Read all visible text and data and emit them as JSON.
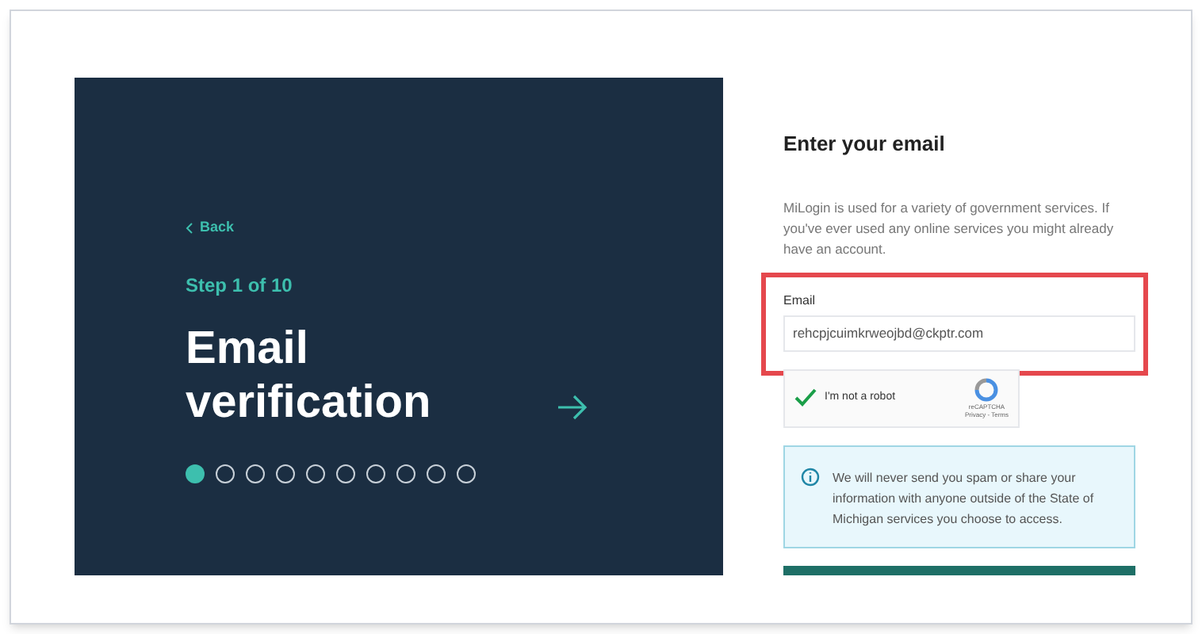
{
  "left_panel": {
    "back_link": "Back",
    "step_label": "Step 1 of 10",
    "title": "Email verification",
    "steps": [
      {
        "selected": true
      },
      {
        "selected": false
      },
      {
        "selected": false
      },
      {
        "selected": false
      },
      {
        "selected": false
      },
      {
        "selected": false
      },
      {
        "selected": false
      },
      {
        "selected": false
      },
      {
        "selected": false
      },
      {
        "selected": false
      }
    ]
  },
  "form": {
    "heading": "Enter your email",
    "intro": "MiLogin is used for a variety of government services. If you've ever used any online services you might already have an account.",
    "email_label": "Email",
    "email_value": "rehcpjcuimkrweojbd@ckptr.com",
    "captcha": {
      "label": "I'm not a robot",
      "checked": true,
      "brand": "reCAPTCHA",
      "links": "Privacy - Terms"
    },
    "notice": "We will never send you spam or share your information with anyone outside of the State of Michigan services you choose to access."
  }
}
